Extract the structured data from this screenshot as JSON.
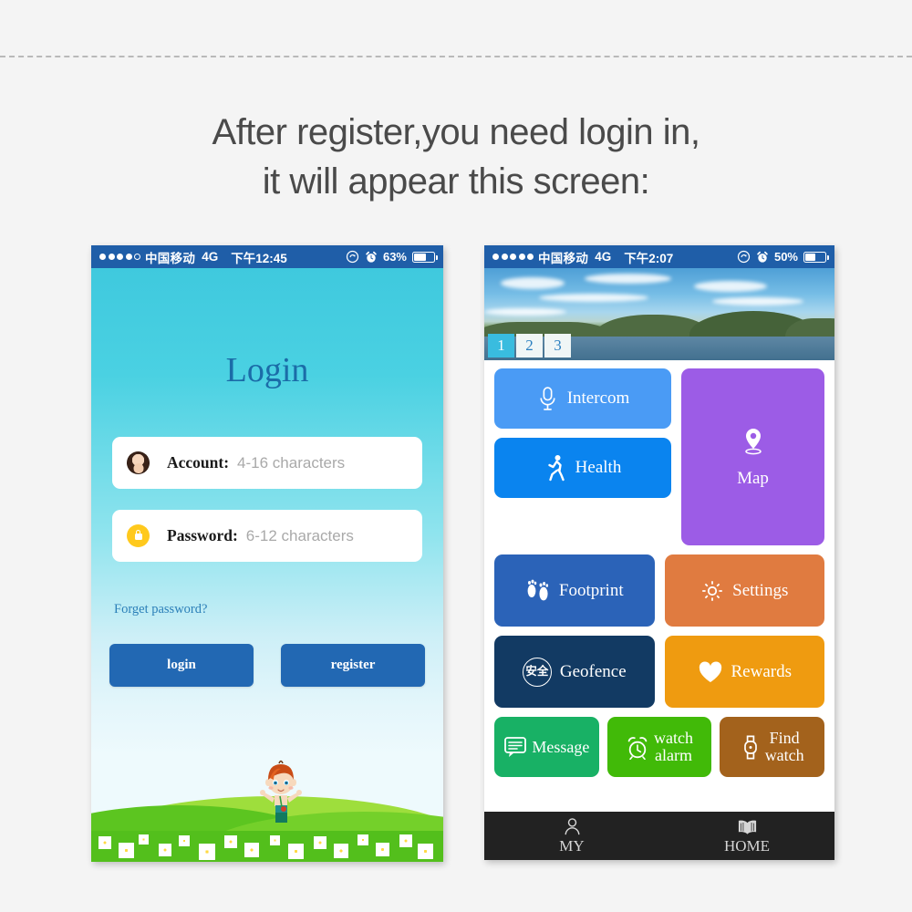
{
  "headline": {
    "line1": "After register,you need login in,",
    "line2": "it will appear this screen:"
  },
  "login_phone": {
    "statusbar": {
      "carrier": "中国移动",
      "network": "4G",
      "time": "下午12:45",
      "battery_pct": "63%",
      "signal_dots_filled": 4,
      "signal_dots_total": 5,
      "rotation_lock_icon": "rotation-lock-icon",
      "alarm_icon": "alarm-clock-icon",
      "battery_icon": "battery-icon"
    },
    "title": "Login",
    "account_field": {
      "icon": "avatar-icon",
      "label": "Account:",
      "placeholder": "4-16 characters",
      "value": ""
    },
    "password_field": {
      "icon": "lock-icon",
      "label": "Password:",
      "placeholder": "6-12 characters",
      "value": ""
    },
    "forget_password": "Forget password?",
    "login_button": "login",
    "register_button": "register",
    "colors": {
      "background_top": "#3fc9de",
      "background_bottom": "#eefafd",
      "title": "#1b6ca8",
      "button": "#2268b3",
      "link": "#2b7fb8",
      "statusbar": "#1f5ea8"
    }
  },
  "home_phone": {
    "statusbar": {
      "carrier": "中国移动",
      "network": "4G",
      "time": "下午2:07",
      "battery_pct": "50%",
      "signal_dots_filled": 5,
      "signal_dots_total": 5,
      "rotation_lock_icon": "rotation-lock-icon",
      "alarm_icon": "alarm-clock-icon",
      "battery_icon": "battery-icon"
    },
    "banner": {
      "description": "landscape-photo-lake-hills",
      "pager": [
        {
          "label": "1",
          "active": true
        },
        {
          "label": "2",
          "active": false
        },
        {
          "label": "3",
          "active": false
        }
      ]
    },
    "tiles": [
      {
        "label": "Intercom",
        "icon": "microphone-icon",
        "color": "#4a9bf5"
      },
      {
        "label": "Health",
        "icon": "running-person-icon",
        "color": "#0a84ef"
      },
      {
        "label": "Map",
        "icon": "map-pin-icon",
        "color": "#9c5ce6"
      },
      {
        "label": "Footprint",
        "icon": "footprints-icon",
        "color": "#2b63b8"
      },
      {
        "label": "Settings",
        "icon": "gear-icon",
        "color": "#e07b40"
      },
      {
        "label": "Geofence",
        "icon": "safety-circle-icon",
        "color": "#123a63"
      },
      {
        "label": "Rewards",
        "icon": "heart-icon",
        "color": "#ef9b10"
      },
      {
        "label": "Message",
        "icon": "speech-bubble-icon",
        "color": "#18b165"
      },
      {
        "label": "watch\nalarm",
        "icon": "alarm-clock-icon",
        "color": "#41ba08"
      },
      {
        "label": "Find\nwatch",
        "icon": "wristwatch-icon",
        "color": "#a3621c"
      }
    ],
    "geofence_icon_text": "安全",
    "navbar": [
      {
        "label": "MY",
        "icon": "person-icon"
      },
      {
        "label": "HOME",
        "icon": "open-book-icon"
      }
    ],
    "colors": {
      "statusbar": "#1f5ea8",
      "navbar": "#222222",
      "pager_active": "#39bcdf"
    }
  }
}
